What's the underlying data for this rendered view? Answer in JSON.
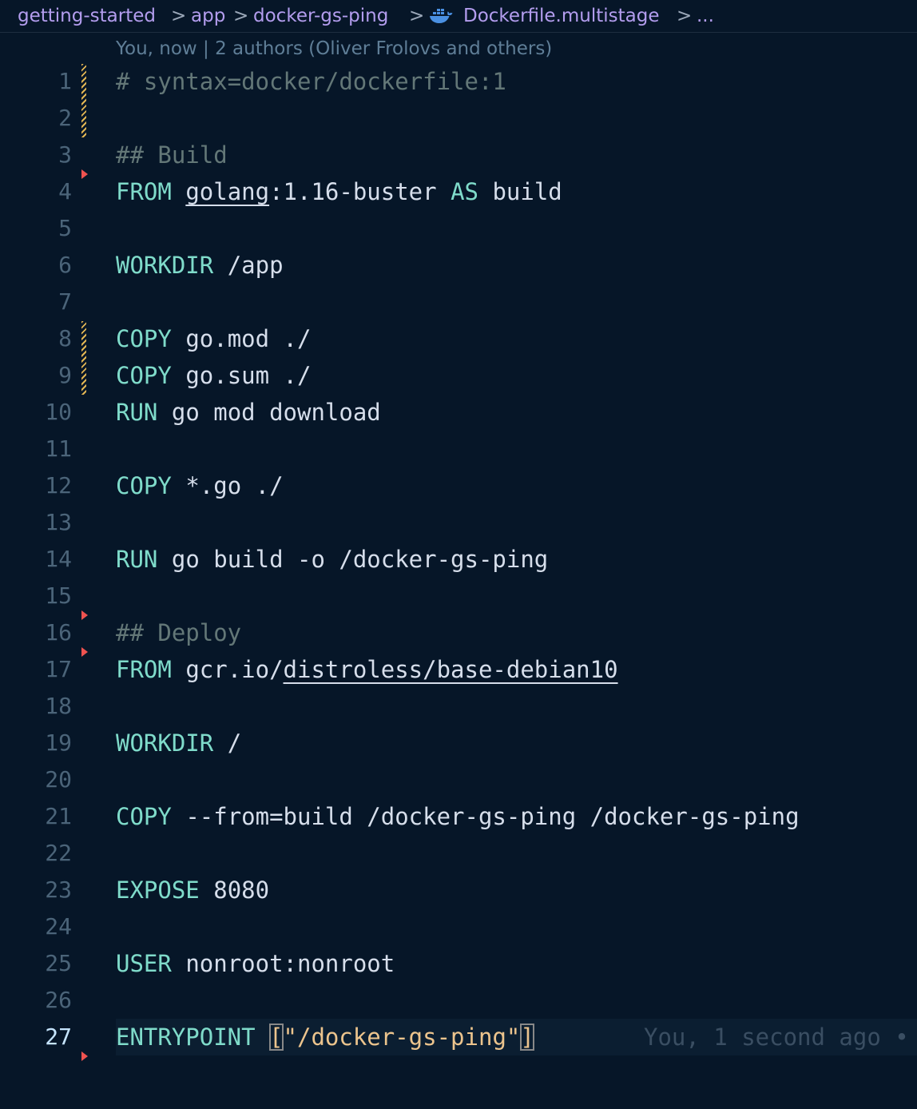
{
  "breadcrumb": {
    "items": [
      "getting-started",
      "app",
      "docker-gs-ping",
      "Dockerfile.multistage",
      "..."
    ],
    "separator": ">"
  },
  "blame_header": "You, now | 2 authors (Oliver Frolovs and others)",
  "inline_blame": "You, 1 second ago •",
  "lines": [
    {
      "n": "1",
      "text": "# syntax=docker/dockerfile:1"
    },
    {
      "n": "2",
      "text": ""
    },
    {
      "n": "3",
      "text": "## Build"
    },
    {
      "n": "4",
      "kw": "FROM",
      "u": "golang",
      "rest": ":1.16-buster",
      "kw2": "AS",
      "rest2": "build"
    },
    {
      "n": "5",
      "text": ""
    },
    {
      "n": "6",
      "kw": "WORKDIR",
      "rest": "/app"
    },
    {
      "n": "7",
      "text": ""
    },
    {
      "n": "8",
      "kw": "COPY",
      "rest": "go.mod ./"
    },
    {
      "n": "9",
      "kw": "COPY",
      "rest": "go.sum ./"
    },
    {
      "n": "10",
      "kw": "RUN",
      "rest": "go mod download"
    },
    {
      "n": "11",
      "text": ""
    },
    {
      "n": "12",
      "kw": "COPY",
      "rest": "*.go ./"
    },
    {
      "n": "13",
      "text": ""
    },
    {
      "n": "14",
      "kw": "RUN",
      "rest": "go build -o /docker-gs-ping"
    },
    {
      "n": "15",
      "text": ""
    },
    {
      "n": "16",
      "text": "## Deploy"
    },
    {
      "n": "17",
      "kw": "FROM",
      "rest": "gcr.io/",
      "u": "distroless/base-debian10"
    },
    {
      "n": "18",
      "text": ""
    },
    {
      "n": "19",
      "kw": "WORKDIR",
      "rest": "/"
    },
    {
      "n": "20",
      "text": ""
    },
    {
      "n": "21",
      "kw": "COPY",
      "rest": "--from=build /docker-gs-ping /docker-gs-ping"
    },
    {
      "n": "22",
      "text": ""
    },
    {
      "n": "23",
      "kw": "EXPOSE",
      "rest": "8080"
    },
    {
      "n": "24",
      "text": ""
    },
    {
      "n": "25",
      "kw": "USER",
      "rest": "nonroot:nonroot"
    },
    {
      "n": "26",
      "text": ""
    },
    {
      "n": "27",
      "kw": "ENTRYPOINT",
      "open": "[",
      "str": "\"/docker-gs-ping\"",
      "close": "]"
    }
  ],
  "colors": {
    "background": "#061628",
    "keyword": "#7fdbca",
    "comment": "#637777",
    "string": "#ecc48d",
    "breadcrumb": "#b39dee",
    "modified_gutter": "#e2b553",
    "deleted_gutter": "#ef5350"
  }
}
